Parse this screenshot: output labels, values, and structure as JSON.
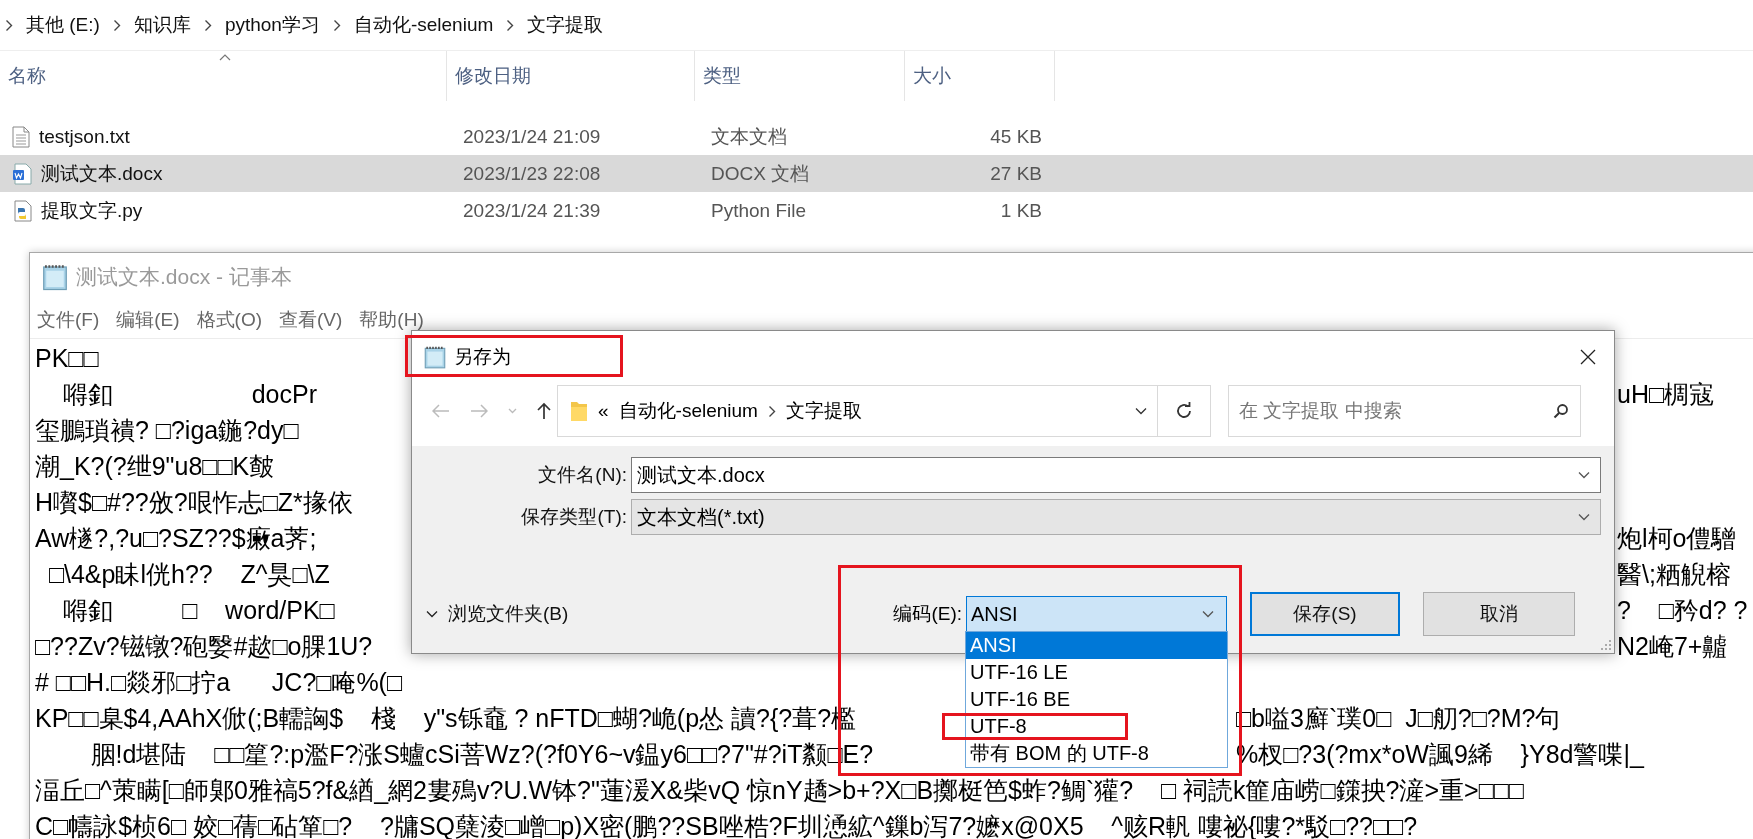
{
  "explorer": {
    "breadcrumb": [
      "其他 (E:)",
      "知识库",
      "python学习",
      "自动化-selenium",
      "文字提取"
    ],
    "columns": [
      "名称",
      "修改日期",
      "类型",
      "大小"
    ],
    "files": [
      {
        "name": "testjson.txt",
        "kind": "text",
        "modified": "2023/1/24 21:09",
        "type": "文本文档",
        "size": "45 KB",
        "selected": false
      },
      {
        "name": "测试文本.docx",
        "kind": "word",
        "modified": "2023/1/23 22:08",
        "type": "DOCX 文档",
        "size": "27 KB",
        "selected": true
      },
      {
        "name": "提取文字.py",
        "kind": "python",
        "modified": "2023/1/24 21:39",
        "type": "Python File",
        "size": "1 KB",
        "selected": false
      }
    ]
  },
  "notepad": {
    "title": "测试文本.docx - 记事本",
    "menu": [
      "文件(F)",
      "编辑(E)",
      "格式(O)",
      "查看(V)",
      "帮助(H)"
    ],
    "lines": [
      {
        "left": "PK□□"
      },
      {
        "left": "    嘚釦                    docPr",
        "right": "uH□椆寇"
      },
      {
        "left": "玺鵬瑣䙡? □?iga鍦?dy□"
      },
      {
        "left": "潮_K?(?绁9\"u8□□K皶"
      },
      {
        "left": "H嚽$□#??攽?哏怍忐□Z*掾依"
      },
      {
        "left": "Aw檖?,?u□?SZ??$瘷a荠;",
        "right": "炮l柯o僼驓"
      },
      {
        "left": "  □\\4&p眛l侊h??    Z^狊□\\Z",
        "right": "醫\\;粞觬榕"
      },
      {
        "left": "    嘚釦          □    word/PK□",
        "right": "?    □矜d? ?"
      },
      {
        "left": "□??Zv?镃镦?砲嫛#趑□o腂1U?",
        "right": "N2崦7+齇"
      },
      {
        "left": "# □□H.□燚邪□拧a      JC?□唵%(□"
      },
      {
        "left": "KP□□臬$4,AAhX俽(;B轜詾$    棧    y\"s铄鼀 ? nFTD□蝴?峗(p怂 讀?{?葺?檻",
        "right": "□b嗌3廯`璞0□  J□舠?□?M?句"
      },
      {
        "left": "        胭!d堪陆    □□篂?:p濫F?涨S蠦cSi菩Wz?(?f0Y6~v鎾y6□□?7\"#?iT颣□E?",
        "right": "%杈□?3(?mx*oW諷9絺    }Y8d警喋|_"
      },
      {
        "left": "湢丘□^茦瞒[□師鄓0雅禞5?f&緧_網2婁殦v?U.W钵?\"蓮湲X&柴vQ 惊nY趫>b+?X□B擲梃笆$蚱?鲷`獾?    □ 祠読k篚庙崂□鏼抰?滻>重>□□□"
      },
      {
        "left": "C□幬詠$桢6□ 姣□蒨□砧箪□?    ?牗SQ蘖淩□嶒□p)X密(鹏??SB唑梏?F圳慂絋^鏁b泻7?嬷x@0X5    ^赅R軓 嘍祕{嘍?*駁□??□□?"
      }
    ]
  },
  "save_dialog": {
    "title": "另存为",
    "title_highlighted": true,
    "address": {
      "overflow": "«",
      "parts": [
        "自动化-selenium",
        "文字提取"
      ]
    },
    "search": {
      "placeholder": "在 文字提取 中搜索"
    },
    "fields": [
      {
        "label": "文件名(N):",
        "value": "测试文本.docx",
        "kind": "text"
      },
      {
        "label": "保存类型(T):",
        "value": "文本文档(*.txt)",
        "kind": "select"
      }
    ],
    "browse": "浏览文件夹(B)",
    "encoding": {
      "label": "编码(E):",
      "value": "ANSI",
      "expanded": true,
      "highlighted": true,
      "options": [
        {
          "label": "ANSI",
          "selected": true,
          "highlighted": false
        },
        {
          "label": "UTF-16 LE",
          "selected": false,
          "highlighted": false
        },
        {
          "label": "UTF-16 BE",
          "selected": false,
          "highlighted": false
        },
        {
          "label": "UTF-8",
          "selected": false,
          "highlighted": true
        },
        {
          "label": "带有 BOM 的 UTF-8",
          "selected": false,
          "highlighted": false
        }
      ]
    },
    "buttons": [
      {
        "label": "保存(S)",
        "default": true
      },
      {
        "label": "取消",
        "default": false
      }
    ]
  }
}
